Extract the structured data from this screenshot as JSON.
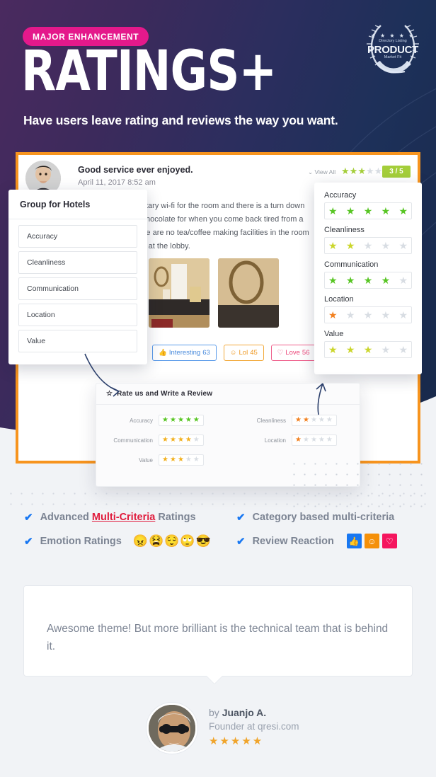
{
  "hero": {
    "badge": "MAJOR ENHANCEMENT",
    "title": "RATINGS+",
    "subtitle": "Have users leave rating and reviews the way you want.",
    "bg_left": "#4a2a5f",
    "bg_right": "#18294a",
    "badge_color": "#e4198b"
  },
  "award": {
    "stars": "★ ★ ★ ★ ★",
    "line1": "Directory Listing",
    "line2": "PRODUCT",
    "line3": "Market Fit"
  },
  "review": {
    "title": "Good service ever enjoyed.",
    "date": "April 11, 2017 8:52 am",
    "view_all": "View All",
    "score_badge": "3 / 5",
    "top_stars_filled": 3,
    "top_stars_total": 5,
    "body": "There is complimentary wi-fi for the room and there is a turn down service with some chocolate for when you come back tired from a whole day out. There are no tea/coffee making facilities in the room but they are outside at the lobby.",
    "reactions": [
      {
        "name": "interesting",
        "icon": "thumbs-up",
        "label": "Interesting",
        "count": "63",
        "color": "#4a8bdc"
      },
      {
        "name": "lol",
        "icon": "smile",
        "label": "Lol",
        "count": "45",
        "color": "#ef9a26"
      },
      {
        "name": "love",
        "icon": "heart",
        "label": "Love",
        "count": "56",
        "color": "#ec477a"
      }
    ]
  },
  "group_panel": {
    "title": "Group for Hotels",
    "items": [
      "Accuracy",
      "Cleanliness",
      "Communication",
      "Location",
      "Value"
    ]
  },
  "breakdown": {
    "criteria": [
      {
        "label": "Accuracy",
        "value": 5,
        "total": 5,
        "color": "#57c523"
      },
      {
        "label": "Cleanliness",
        "value": 2,
        "total": 5,
        "color": "#cbd62c"
      },
      {
        "label": "Communication",
        "value": 4,
        "total": 5,
        "color": "#57c523"
      },
      {
        "label": "Location",
        "value": 1,
        "total": 5,
        "color": "#f2801f"
      },
      {
        "label": "Value",
        "value": 3,
        "total": 5,
        "color": "#cbd62c"
      }
    ]
  },
  "rate_panel": {
    "heading": "Rate us and Write a Review",
    "left": [
      {
        "label": "Accuracy",
        "value": 5,
        "total": 5,
        "color": "#57c523"
      },
      {
        "label": "Communication",
        "value": 4,
        "total": 5,
        "color": "#f2b01e"
      },
      {
        "label": "Value",
        "value": 3,
        "total": 5,
        "color": "#f2b01e"
      }
    ],
    "right": [
      {
        "label": "Cleanliness",
        "value": 2,
        "total": 5,
        "color": "#f2801f"
      },
      {
        "label": "Location",
        "value": 1,
        "total": 5,
        "color": "#f2801f"
      }
    ]
  },
  "features": {
    "row1_left_a": "Advanced ",
    "row1_left_hl": "Multi-Criteria",
    "row1_left_b": " Ratings",
    "row1_right": "Category based multi-criteria",
    "row2_left": "Emotion Ratings",
    "row2_right": "Review Reaction",
    "emotions": [
      "😠",
      "😫",
      "😌",
      "🙄",
      "😎"
    ],
    "reaction_icons": [
      {
        "name": "thumbs-up-icon",
        "glyph": "👍",
        "bg": "#1877f2"
      },
      {
        "name": "smile-icon",
        "glyph": "☺",
        "bg": "#f59009"
      },
      {
        "name": "heart-icon",
        "glyph": "♡",
        "bg": "#f5155e"
      }
    ],
    "check": "✔"
  },
  "testimonial": {
    "quote": "Awesome theme! But more brilliant is the technical team that is behind it.",
    "by_prefix": "by ",
    "author": "Juanjo A.",
    "role": "Founder at qresi.com",
    "stars": "★★★★★"
  }
}
